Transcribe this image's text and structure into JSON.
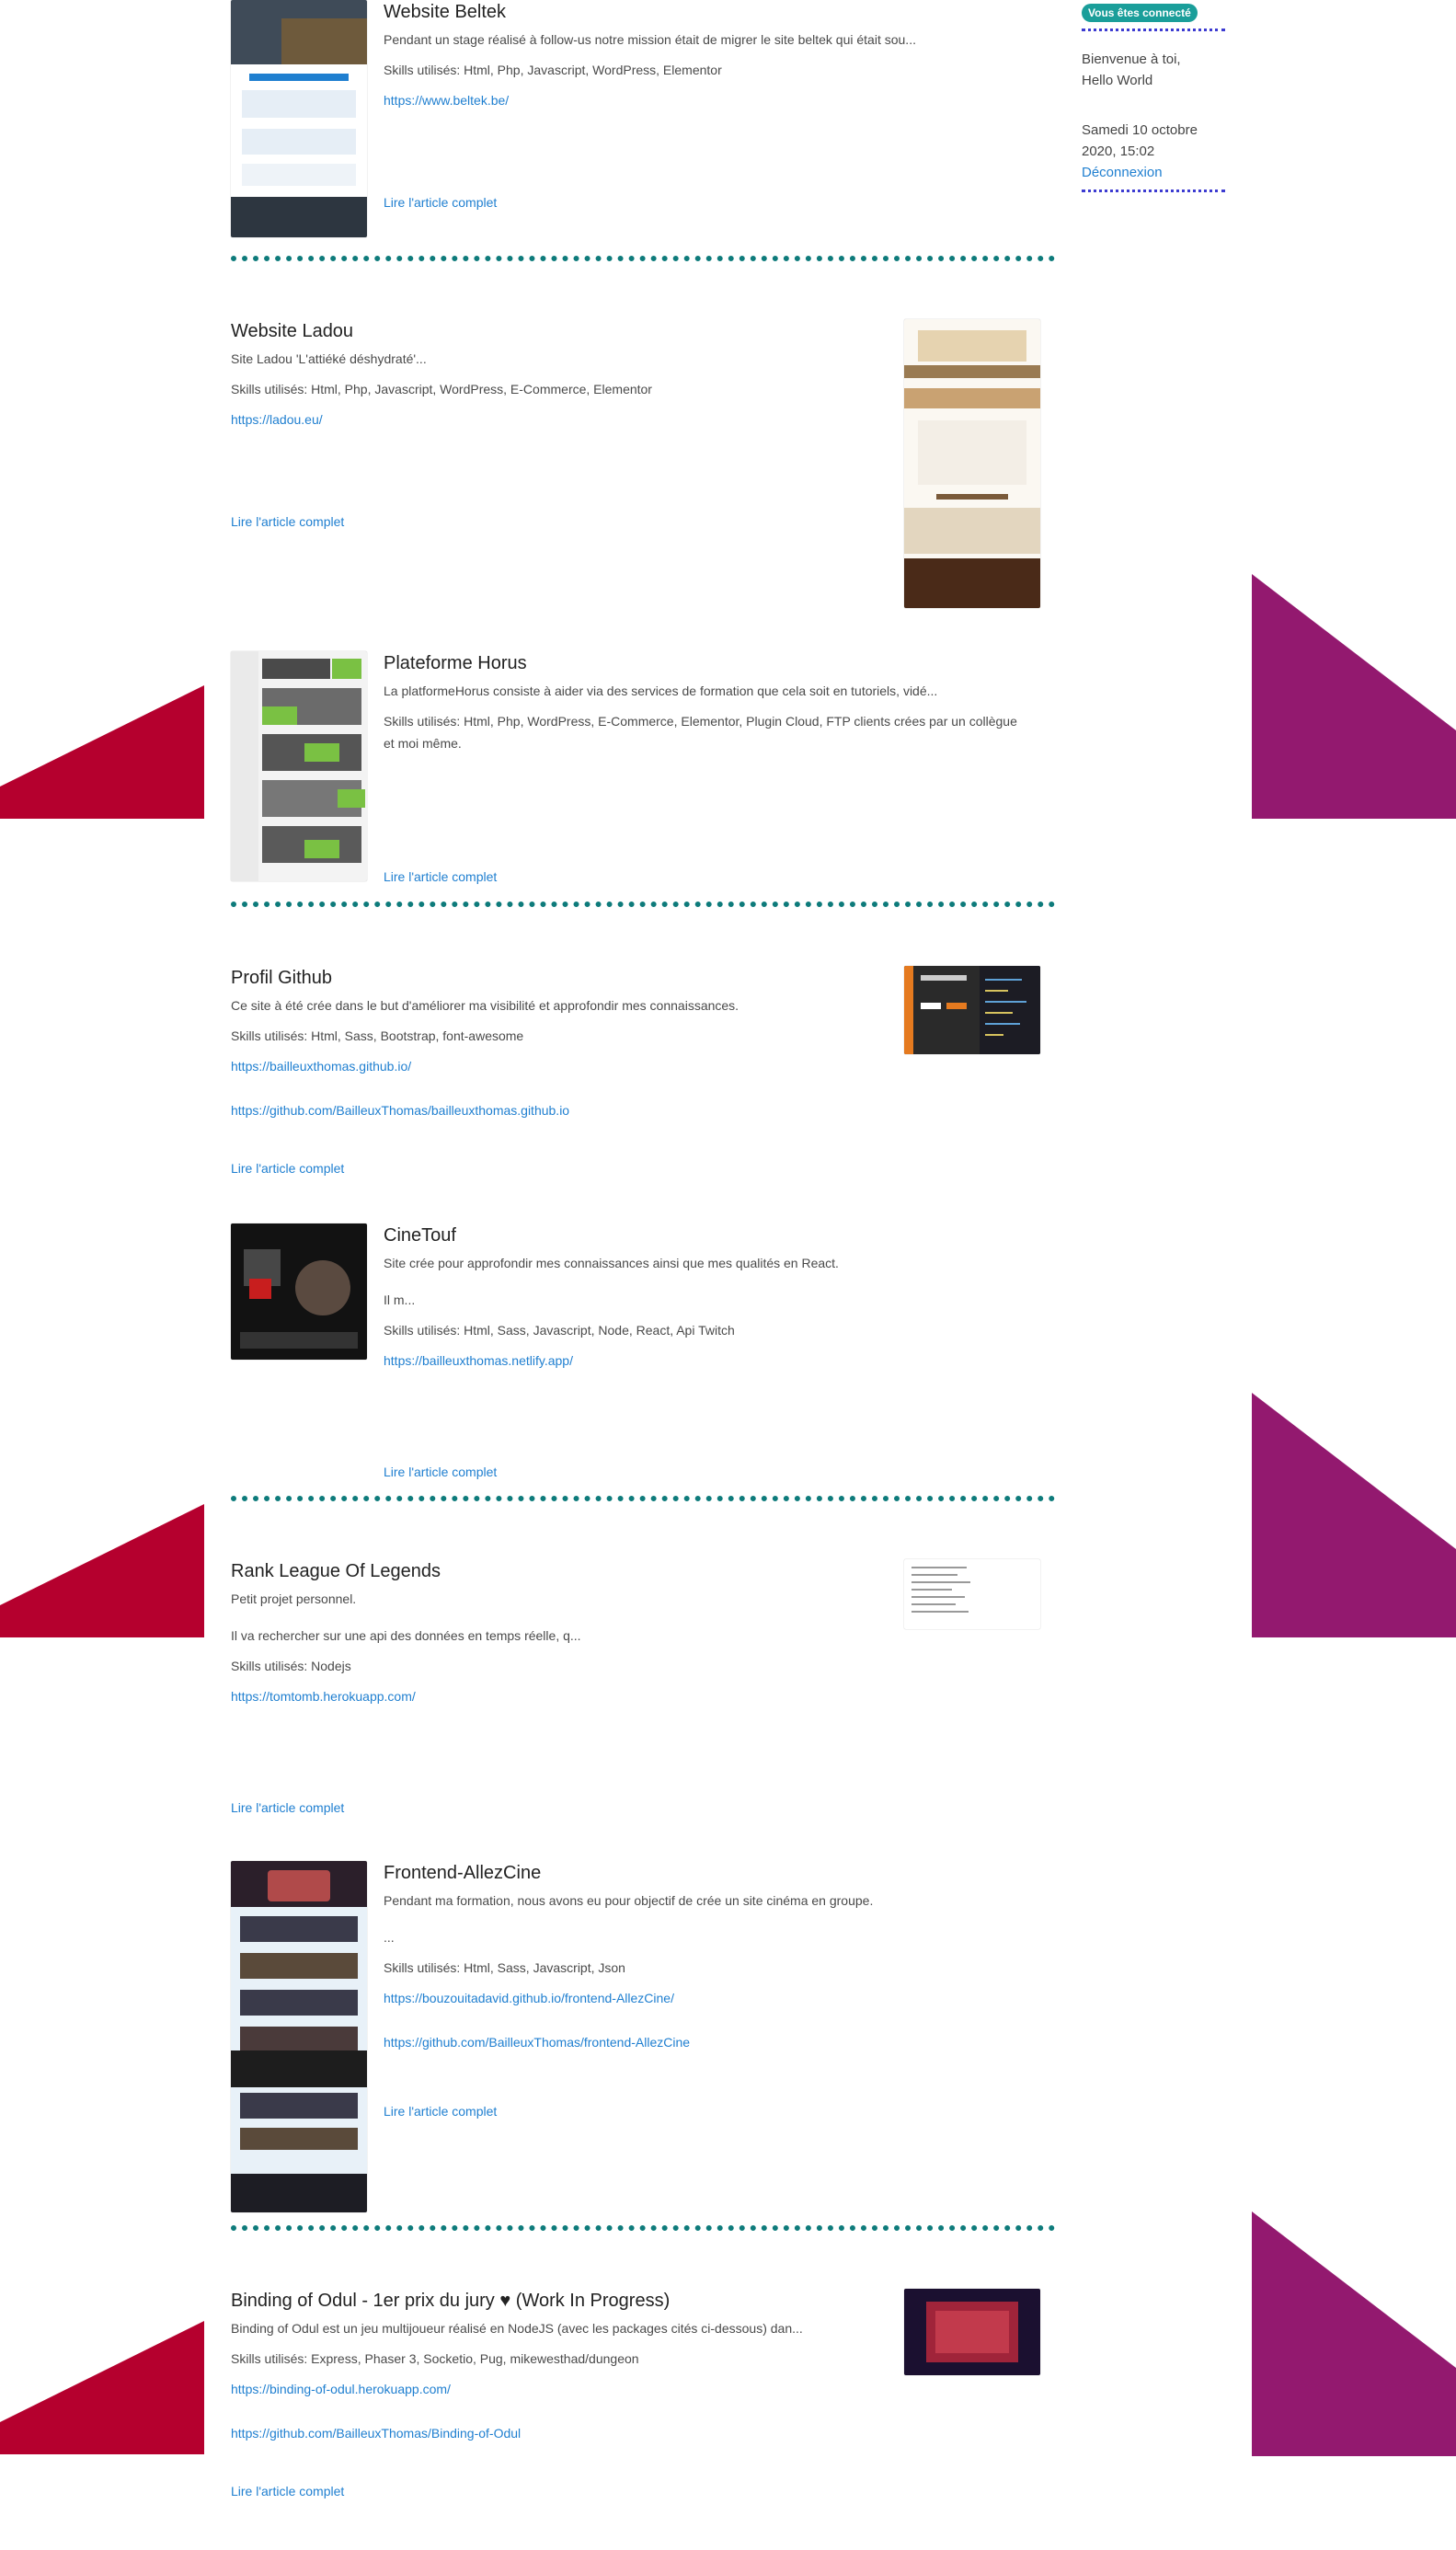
{
  "sidebar": {
    "status_badge": "Vous êtes connecté",
    "welcome_line1": "Bienvenue à toi,",
    "welcome_line2": "Hello World",
    "date_line1": "Samedi 10 octobre",
    "date_line2": "2020, 15:02",
    "logout_label": "Déconnexion"
  },
  "articles": [
    {
      "title": "Website Beltek",
      "excerpt": "Pendant un stage réalisé à follow-us notre mission était de migrer le site beltek qui était sou...",
      "skills": "Skills utilisés: Html, Php, Javascript, WordPress, Elementor",
      "links": [
        "https://www.beltek.be/"
      ],
      "read_more": "Lire l'article complet"
    },
    {
      "title": "Website Ladou",
      "excerpt": "Site Ladou 'L'attiéké déshydraté'...",
      "skills": "Skills utilisés: Html, Php, Javascript, WordPress, E-Commerce, Elementor",
      "links": [
        "https://ladou.eu/"
      ],
      "read_more": "Lire l'article complet"
    },
    {
      "title": "Plateforme Horus",
      "excerpt": "La platformeHorus consiste à aider via des services de formation que cela soit en tutoriels, vidé...",
      "skills": "Skills utilisés: Html, Php, WordPress, E-Commerce, Elementor, Plugin Cloud, FTP clients crées par un collègue et moi même.",
      "links": [],
      "read_more": "Lire l'article complet"
    },
    {
      "title": "Profil Github",
      "excerpt": "Ce site à été crée dans le but d'améliorer ma visibilité et approfondir mes connaissances.",
      "skills": "Skills utilisés: Html, Sass, Bootstrap, font-awesome",
      "links": [
        "https://bailleuxthomas.github.io/",
        "https://github.com/BailleuxThomas/bailleuxthomas.github.io"
      ],
      "read_more": "Lire l'article complet"
    },
    {
      "title": "CineTouf",
      "excerpt": "Site crée pour approfondir mes connaissances ainsi que mes qualités en React.",
      "excerpt2": "Il m...",
      "skills": "Skills utilisés: Html, Sass, Javascript, Node, React, Api Twitch",
      "links": [
        "https://bailleuxthomas.netlify.app/"
      ],
      "read_more": "Lire l'article complet"
    },
    {
      "title": "Rank League Of Legends",
      "excerpt": "Petit projet personnel.",
      "excerpt2": "Il va rechercher sur une api des données en temps réelle, q...",
      "skills": "Skills utilisés: Nodejs",
      "links": [
        "https://tomtomb.herokuapp.com/"
      ],
      "read_more": "Lire l'article complet"
    },
    {
      "title": "Frontend-AllezCine",
      "excerpt": "Pendant ma formation, nous avons eu pour objectif de crée un site cinéma en groupe.",
      "excerpt2": "...",
      "skills": "Skills utilisés: Html, Sass, Javascript, Json",
      "links": [
        "https://bouzouitadavid.github.io/frontend-AllezCine/",
        "https://github.com/BailleuxThomas/frontend-AllezCine"
      ],
      "read_more": "Lire l'article complet"
    },
    {
      "title": "Binding of Odul - 1er prix du jury ♥ (Work In Progress)",
      "excerpt": "Binding of Odul est un jeu multijoueur réalisé en NodeJS (avec les packages cités ci-dessous) dan...",
      "skills": "Skills utilisés: Express, Phaser 3, Socketio, Pug, mikewesthad/dungeon",
      "links": [
        "https://binding-of-odul.herokuapp.com/",
        "https://github.com/BailleuxThomas/Binding-of-Odul"
      ],
      "read_more": "Lire l'article complet"
    }
  ],
  "colors": {
    "accent_teal": "#0e7b7b",
    "link_blue": "#1f7fd0",
    "badge_teal": "#1a9e9a",
    "deco_red": "#b5002e",
    "deco_purple": "#93196f"
  }
}
